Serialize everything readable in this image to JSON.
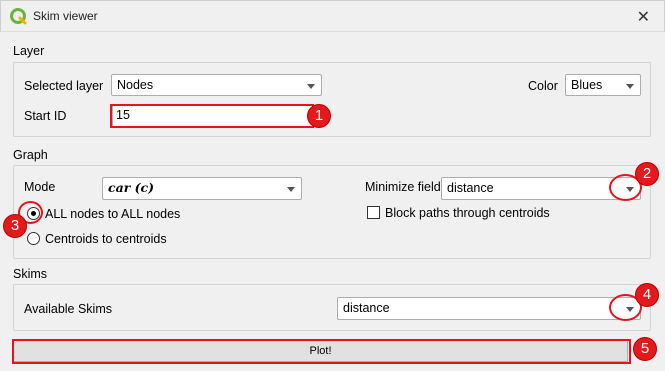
{
  "window": {
    "title": "Skim viewer",
    "close_icon": "close-icon",
    "logo_icon": "qgis-logo-icon"
  },
  "layer": {
    "section": "Layer",
    "selected_layer_label": "Selected layer",
    "selected_layer_value": "Nodes",
    "color_label": "Color",
    "color_value": "Blues",
    "start_id_label": "Start ID",
    "start_id_value": "15"
  },
  "graph": {
    "section": "Graph",
    "mode_label": "Mode",
    "mode_value": "car (c)",
    "minimize_field_label": "Minimize field",
    "minimize_field_value": "distance",
    "radio_all_nodes": "ALL nodes to ALL nodes",
    "radio_centroids": "Centroids to centroids",
    "block_paths_label": "Block paths through centroids",
    "all_nodes_checked": true,
    "block_paths_checked": false
  },
  "skims": {
    "section": "Skims",
    "available_label": "Available Skims",
    "available_value": "distance"
  },
  "plot_button": "Plot!",
  "annotations": [
    "1",
    "2",
    "3",
    "4",
    "5"
  ],
  "colors": {
    "highlight": "#e8141b",
    "badge": "#e31a1c"
  }
}
